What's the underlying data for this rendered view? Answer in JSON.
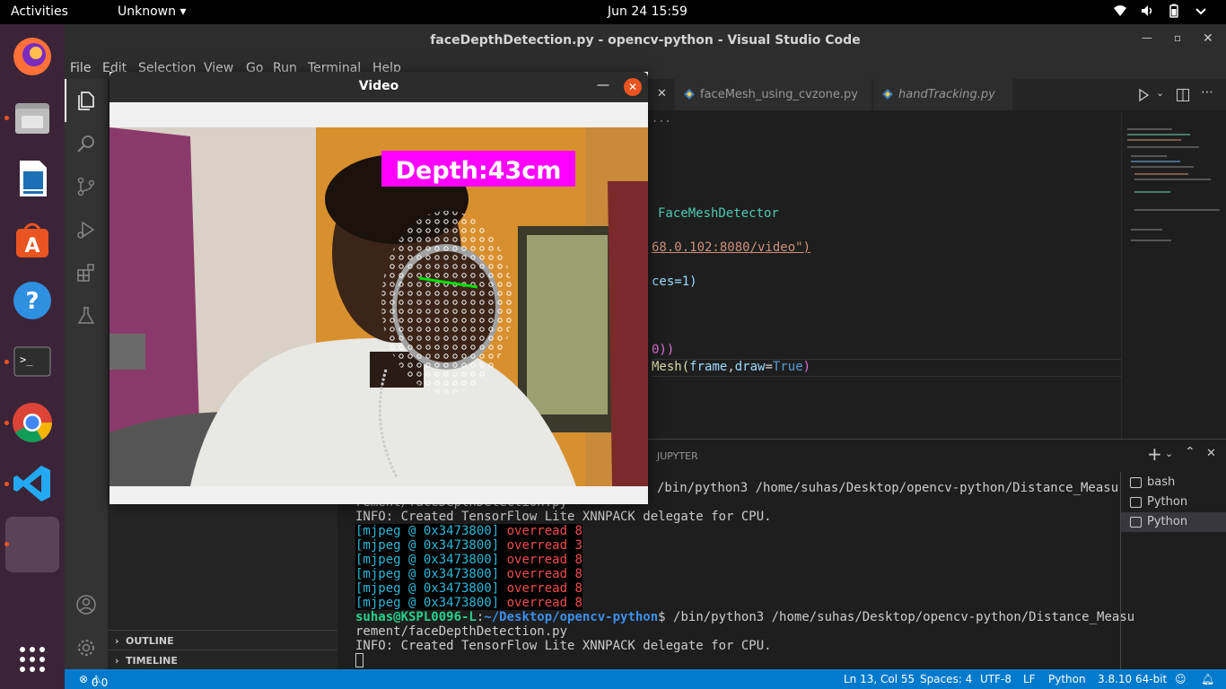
{
  "topbar": {
    "activities": "Activities",
    "app_menu": "Unknown",
    "clock": "Jun 24  15:59"
  },
  "dock": {
    "apps": [
      "firefox-icon",
      "files-icon",
      "writer-icon",
      "software-icon",
      "help-icon",
      "terminal-icon",
      "chrome-icon",
      "vscode-icon",
      "active-window-icon",
      "show-apps-icon"
    ]
  },
  "vscode": {
    "title": "faceDepthDetection.py - opencv-python - Visual Studio Code",
    "menu": [
      "File",
      "Edit",
      "Selection",
      "View",
      "Go",
      "Run",
      "Terminal",
      "Help"
    ],
    "tabs": [
      {
        "label": "faceMesh_using_cvzone.py"
      },
      {
        "label": "handTracking.py"
      }
    ],
    "breadcrumb_ellipsis": "...",
    "code": {
      "line_a": "FaceMeshDetector",
      "line_b": "68.0.102:8080/video\")",
      "line_c": "ces=1)",
      "line_d": "0))",
      "line_e_1": "Mesh(",
      "line_e_2": "frame",
      "line_e_3": ",",
      "line_e_4": "draw",
      "line_e_5": "=",
      "line_e_6": "True",
      "line_e_7": ")"
    },
    "sidebar": {
      "outline": "OUTLINE",
      "timeline": "TIMELINE"
    },
    "panel": {
      "tab_jupyter": "JUPYTER",
      "terminal_lines": {
        "l1": "/bin/python3 /home/suhas/Desktop/opencv-python/Distance_Measu",
        "l2": "rement/faceDepthDetection.py",
        "l3": "INFO: Created TensorFlow Lite XNNPACK delegate for CPU.",
        "mj": "[mjpeg @ 0x3473800]",
        "ov8": "overread 8",
        "ov3": "overread 3",
        "prompt_user": "suhas@KSPL0096-L",
        "prompt_colon": ":",
        "prompt_path": "~/Desktop/opencv-python",
        "prompt_cmd": "$ /bin/python3 /home/suhas/Desktop/opencv-python/Distance_Measu",
        "l10": "rement/faceDepthDetection.py",
        "l11": "INFO: Created TensorFlow Lite XNNPACK delegate for CPU."
      },
      "terminals": [
        "bash",
        "Python",
        "Python"
      ]
    },
    "status": {
      "problems_errors": "0",
      "problems_warnings": "0",
      "position": "Ln 13, Col 55",
      "spaces": "Spaces: 4",
      "encoding": "UTF-8",
      "eol": "LF",
      "language": "Python",
      "interpreter": "3.8.10 64-bit"
    }
  },
  "video_window": {
    "title": "Video",
    "depth_label": "Depth:43cm"
  },
  "colors": {
    "vscode_blue": "#007acc",
    "dock_bg": "#3b2438",
    "depth_bg": "#ff00ff",
    "ubuntu_orange": "#e95420"
  }
}
